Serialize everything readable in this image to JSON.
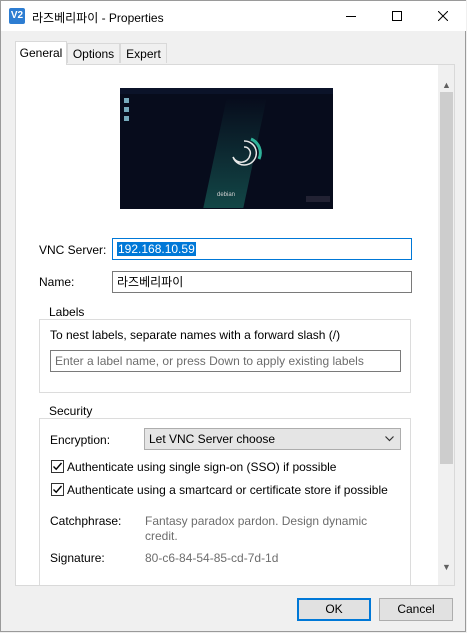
{
  "window": {
    "app_icon_text": "V2",
    "title": "라즈베리파이 - Properties"
  },
  "tabs": [
    {
      "label": "General",
      "active": true
    },
    {
      "label": "Options",
      "active": false
    },
    {
      "label": "Expert",
      "active": false
    }
  ],
  "preview": {
    "os_label": "debian"
  },
  "general": {
    "vnc_server_label": "VNC Server:",
    "vnc_server_value": "192.168.10.59",
    "name_label": "Name:",
    "name_value": "라즈베리파이"
  },
  "labels_group": {
    "title": "Labels",
    "hint": "To nest labels, separate names with a forward slash (/)",
    "input_placeholder": "Enter a label name, or press Down to apply existing labels"
  },
  "security_group": {
    "title": "Security",
    "encryption_label": "Encryption:",
    "encryption_value": "Let VNC Server choose",
    "sso_label": "Authenticate using single sign-on (SSO) if possible",
    "sso_checked": true,
    "smartcard_label": "Authenticate using a smartcard or certificate store if possible",
    "smartcard_checked": true,
    "catchphrase_label": "Catchphrase:",
    "catchphrase_line1": "Fantasy paradox pardon. Design dynamic",
    "catchphrase_line2": "credit.",
    "signature_label": "Signature:",
    "signature_value": "80-c6-84-54-85-cd-7d-1d"
  },
  "buttons": {
    "ok": "OK",
    "cancel": "Cancel"
  },
  "colors": {
    "accent": "#0078d7",
    "app_icon": "#2d7dd2"
  }
}
